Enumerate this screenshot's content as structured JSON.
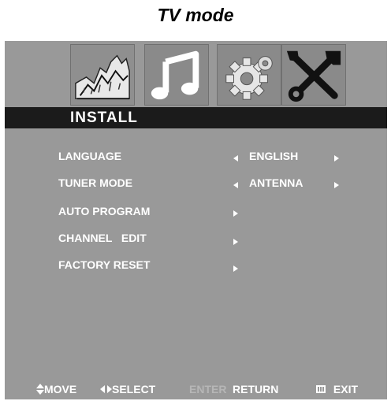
{
  "page": {
    "title": "TV mode"
  },
  "tabs": [
    {
      "icon": "picture-icon",
      "name": "picture"
    },
    {
      "icon": "music-note-icon",
      "name": "audio"
    },
    {
      "icon": "gear-icon",
      "name": "setup"
    },
    {
      "icon": "tools-icon",
      "name": "install",
      "selected": true
    }
  ],
  "section": {
    "title": "INSTALL"
  },
  "menu": [
    {
      "label": "LANGUAGE",
      "value": "ENGLISH",
      "left_arrow": true,
      "right_arrow": true
    },
    {
      "label": "TUNER MODE",
      "value": "ANTENNA",
      "left_arrow": true,
      "right_arrow": true
    },
    {
      "label": "AUTO PROGRAM",
      "value": "",
      "left_arrow": false,
      "right_arrow": true
    },
    {
      "label": "CHANNEL   EDIT",
      "value": "",
      "left_arrow": false,
      "right_arrow": true
    },
    {
      "label": "FACTORY RESET",
      "value": "",
      "left_arrow": false,
      "right_arrow": true
    }
  ],
  "footer": {
    "move": "MOVE",
    "select": "SELECT",
    "enter": "ENTER",
    "return": "RETURN",
    "exit": "EXIT"
  },
  "colors": {
    "osd_background": "#999999",
    "section_bar": "#1b1b1b",
    "text": "#ffffff"
  }
}
